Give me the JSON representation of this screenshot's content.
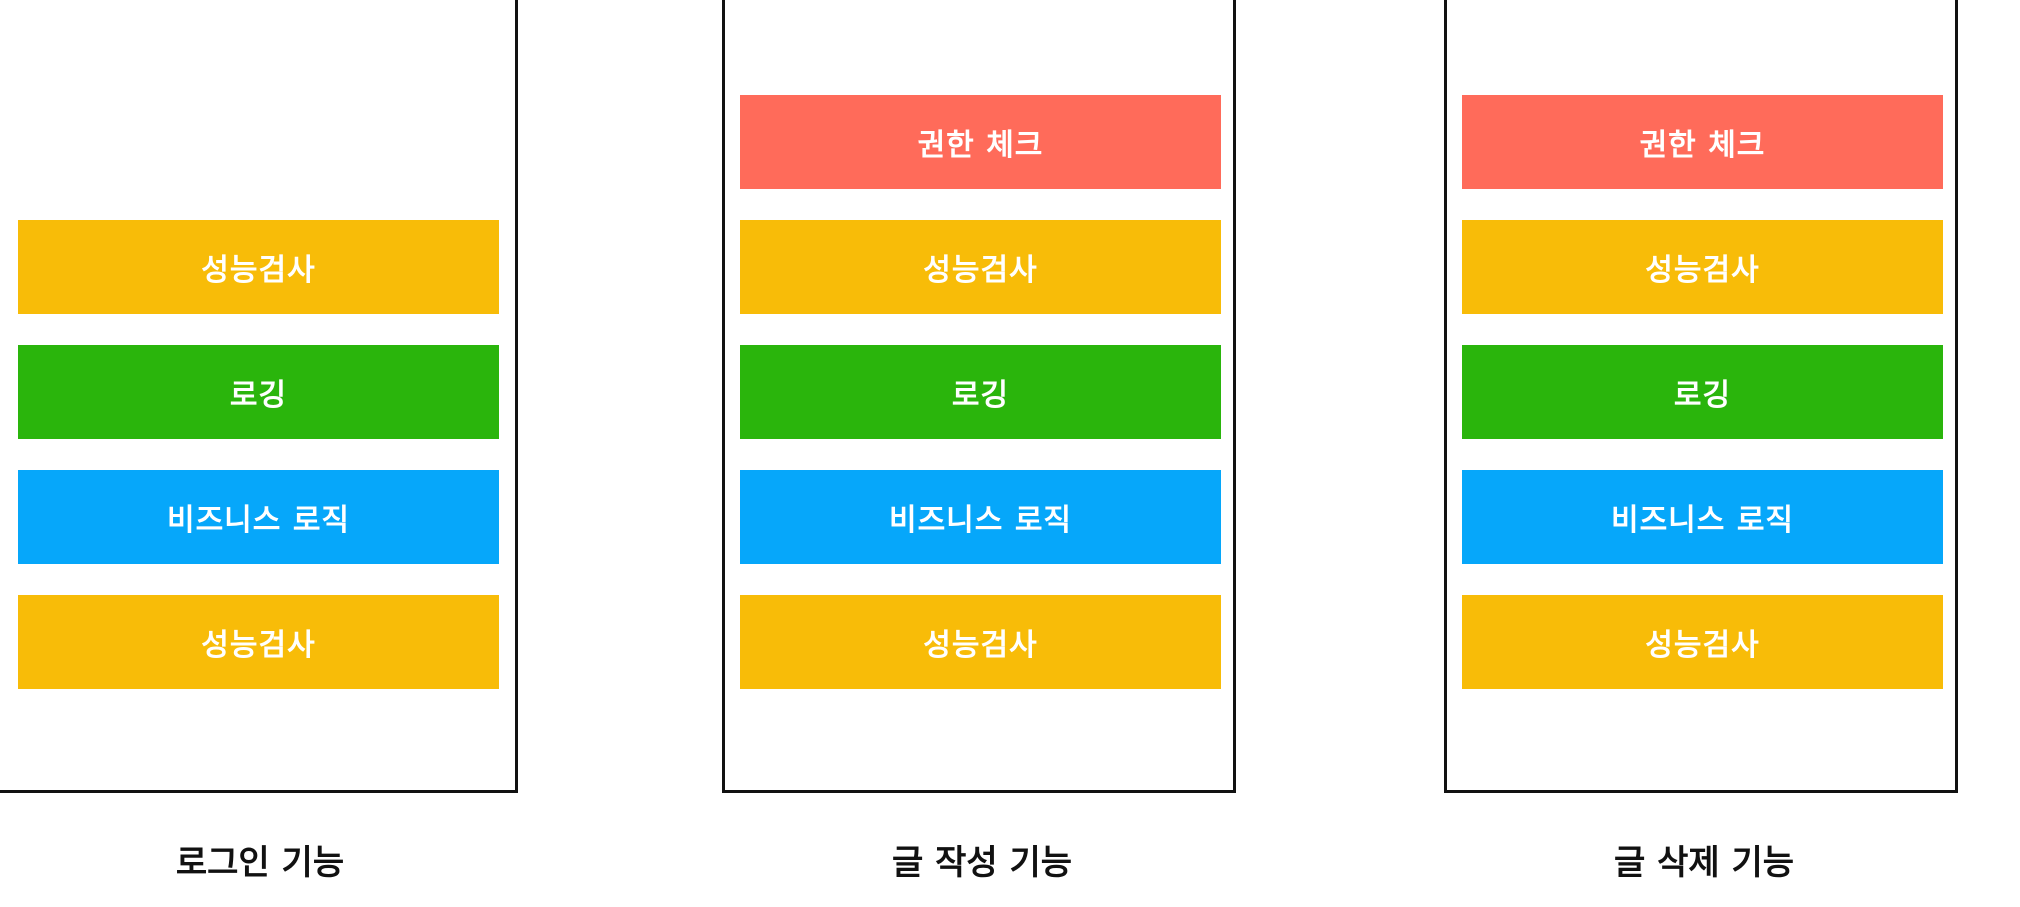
{
  "colors": {
    "permission": "#FF6B5A",
    "performance": "#F8BC08",
    "logging": "#2AB50C",
    "business": "#06A7FA",
    "frame_border": "#111111"
  },
  "columns": [
    {
      "caption": "로그인 기능",
      "blocks": [
        null,
        {
          "label": "성능검사",
          "color_key": "performance"
        },
        {
          "label": "로깅",
          "color_key": "logging"
        },
        {
          "label": "비즈니스 로직",
          "color_key": "business"
        },
        {
          "label": "성능검사",
          "color_key": "performance"
        }
      ]
    },
    {
      "caption": "글 작성 기능",
      "blocks": [
        {
          "label": "권한 체크",
          "color_key": "permission"
        },
        {
          "label": "성능검사",
          "color_key": "performance"
        },
        {
          "label": "로깅",
          "color_key": "logging"
        },
        {
          "label": "비즈니스 로직",
          "color_key": "business"
        },
        {
          "label": "성능검사",
          "color_key": "performance"
        }
      ]
    },
    {
      "caption": "글 삭제 기능",
      "blocks": [
        {
          "label": "권한 체크",
          "color_key": "permission"
        },
        {
          "label": "성능검사",
          "color_key": "performance"
        },
        {
          "label": "로깅",
          "color_key": "logging"
        },
        {
          "label": "비즈니스 로직",
          "color_key": "business"
        },
        {
          "label": "성능검사",
          "color_key": "performance"
        }
      ]
    }
  ]
}
